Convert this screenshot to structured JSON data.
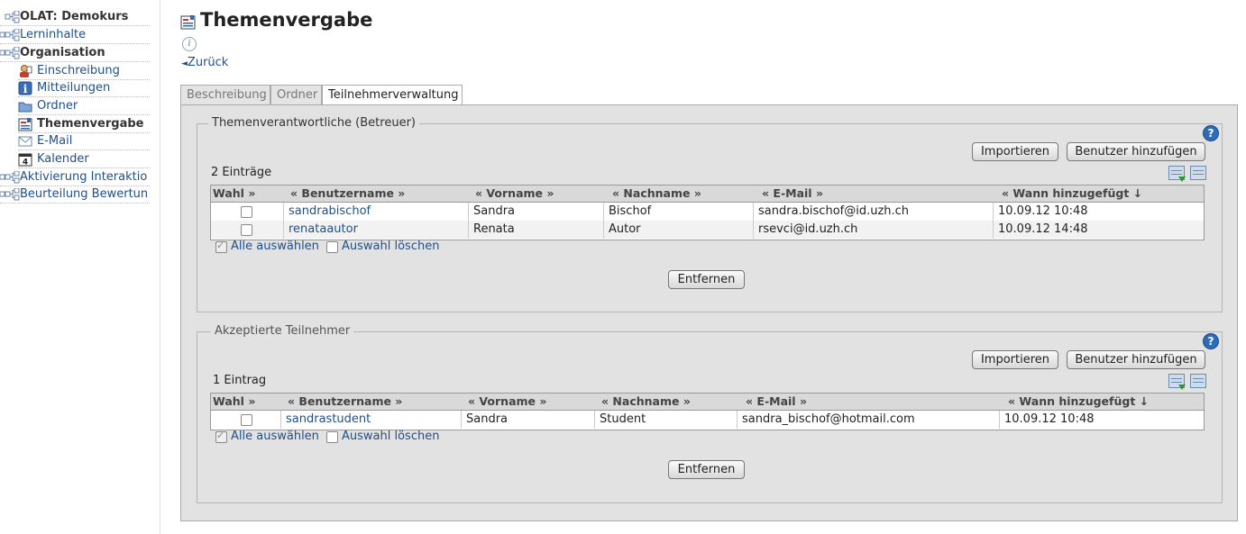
{
  "sidebar": {
    "items": [
      {
        "label": "OLAT: Demokurs"
      },
      {
        "label": "Lerninhalte"
      },
      {
        "label": "Organisation"
      },
      {
        "label": "Einschreibung"
      },
      {
        "label": "Mitteilungen"
      },
      {
        "label": "Ordner"
      },
      {
        "label": "Themenvergabe"
      },
      {
        "label": "E-Mail"
      },
      {
        "label": "Kalender"
      },
      {
        "label": "Aktivierung Interaktio"
      },
      {
        "label": "Beurteilung Bewertun"
      }
    ]
  },
  "page": {
    "title": "Themenvergabe",
    "back_label": "Zurück",
    "info_glyph": "i"
  },
  "tabs": [
    {
      "label": "Beschreibung"
    },
    {
      "label": "Ordner"
    },
    {
      "label": "Teilnehmerverwaltung"
    }
  ],
  "sections": [
    {
      "legend": "Themenverantwortliche (Betreuer)",
      "import_label": "Importieren",
      "add_label": "Benutzer hinzufügen",
      "count": "2 Einträge",
      "headers": [
        "Wahl »",
        "« Benutzername »",
        "« Vorname »",
        "« Nachname »",
        "« E-Mail »",
        "« Wann hinzugefügt ↓"
      ],
      "rows": [
        {
          "username": "sandrabischof",
          "first": "Sandra",
          "last": "Bischof",
          "email": "sandra.bischof@id.uzh.ch",
          "added": "10.09.12 10:48"
        },
        {
          "username": "renataautor",
          "first": "Renata",
          "last": "Autor",
          "email": "rsevci@id.uzh.ch",
          "added": "10.09.12 14:48"
        }
      ],
      "select_all": "Alle auswählen",
      "clear_selection": "Auswahl löschen",
      "remove_label": "Entfernen"
    },
    {
      "legend": "Akzeptierte Teilnehmer",
      "import_label": "Importieren",
      "add_label": "Benutzer hinzufügen",
      "count": "1 Eintrag",
      "headers": [
        "Wahl »",
        "« Benutzername »",
        "« Vorname »",
        "« Nachname »",
        "« E-Mail »",
        "« Wann hinzugefügt ↓"
      ],
      "rows": [
        {
          "username": "sandrastudent",
          "first": "Sandra",
          "last": "Student",
          "email": "sandra_bischof@hotmail.com",
          "added": "10.09.12 10:48"
        }
      ],
      "select_all": "Alle auswählen",
      "clear_selection": "Auswahl löschen",
      "remove_label": "Entfernen"
    }
  ],
  "help_glyph": "?"
}
